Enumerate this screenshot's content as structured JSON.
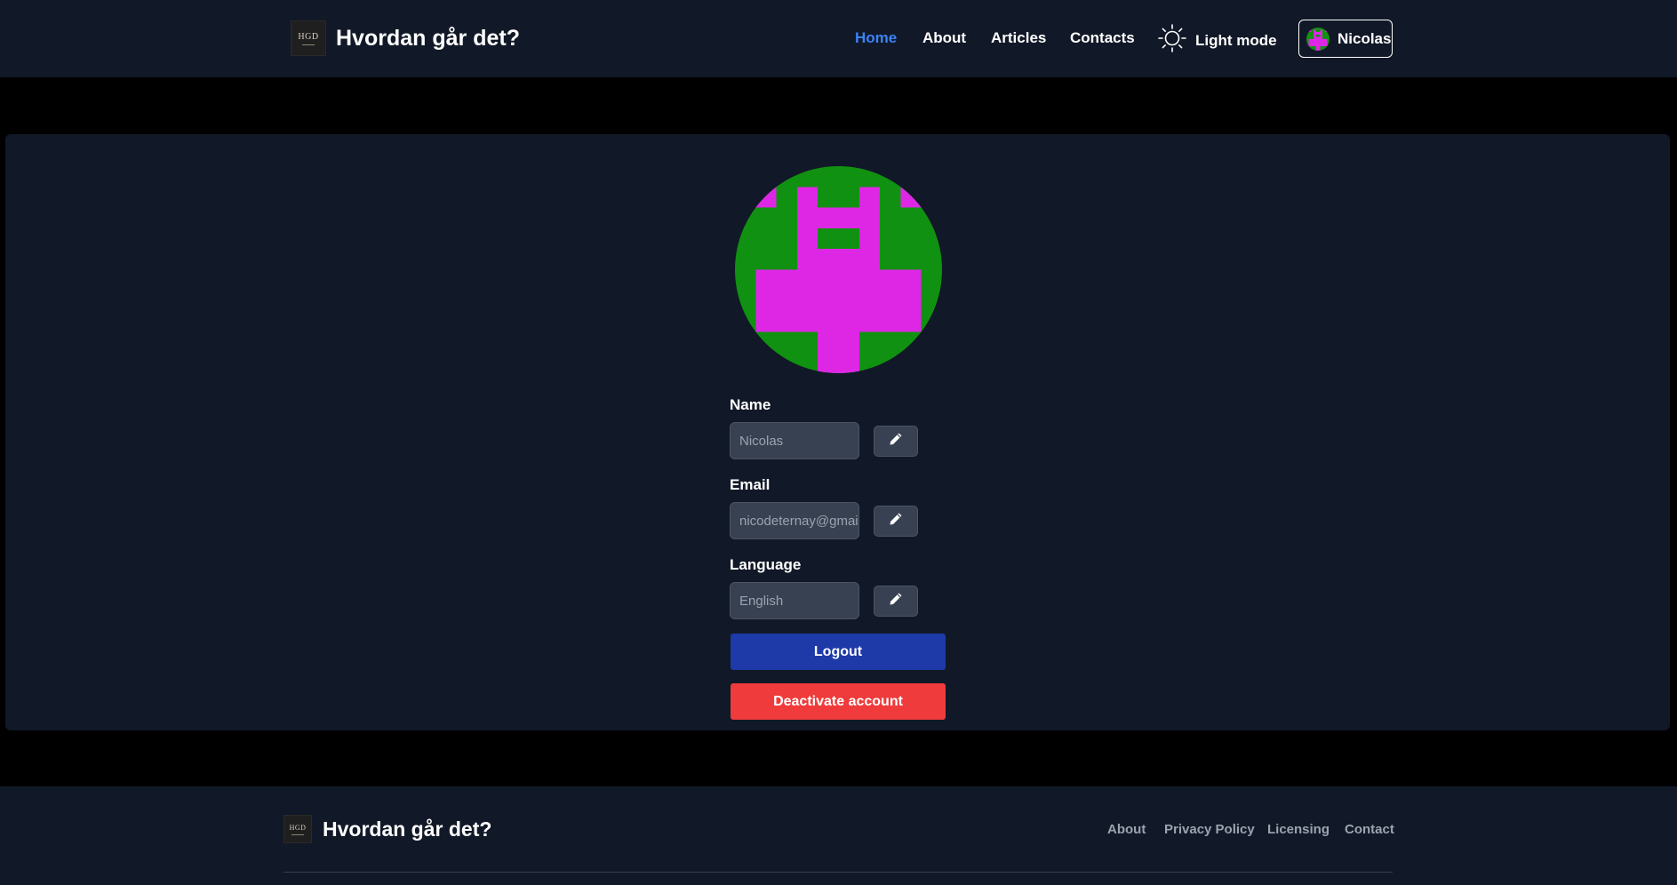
{
  "header": {
    "logo_text": "HGD",
    "site_title": "Hvordan går det?",
    "nav": {
      "home": "Home",
      "about": "About",
      "articles": "Articles",
      "contacts": "Contacts"
    },
    "theme_toggle_label": "Light mode",
    "user_name": "Nicolas"
  },
  "profile": {
    "avatar_colors": {
      "background": "#119111",
      "figure": "#dd27e5"
    },
    "name": {
      "label": "Name",
      "value": "Nicolas"
    },
    "email": {
      "label": "Email",
      "value": "nicodeternay@gmail.com"
    },
    "language": {
      "label": "Language",
      "value": "English"
    },
    "logout_label": "Logout",
    "deactivate_label": "Deactivate account"
  },
  "footer": {
    "logo_text": "HGD",
    "site_title": "Hvordan går det?",
    "links": {
      "about": "About",
      "privacy": "Privacy Policy",
      "licensing": "Licensing",
      "contact": "Contact"
    }
  },
  "colors": {
    "nav_active": "#3b82f6",
    "logout_button": "#1e3aa8",
    "deactivate_button": "#ef3b3b",
    "surface": "#111827"
  }
}
